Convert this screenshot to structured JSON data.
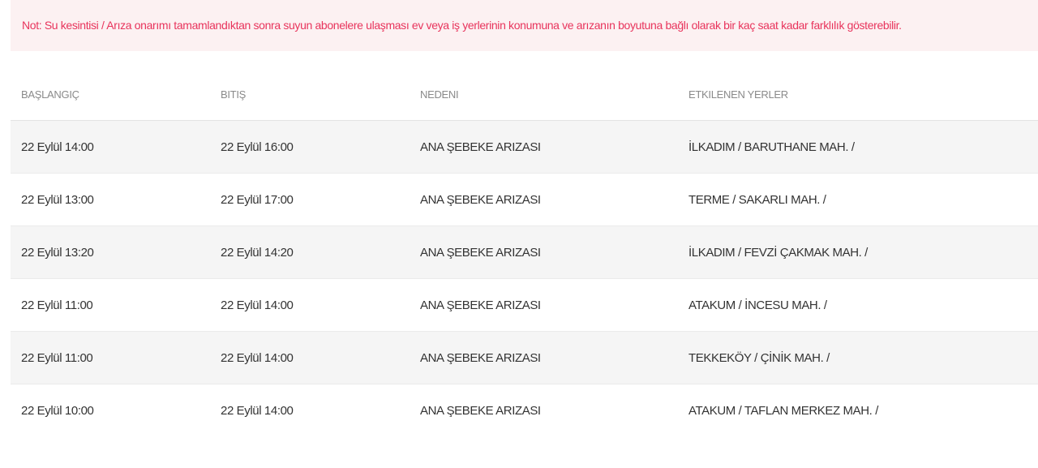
{
  "notice": {
    "text": "Not: Su kesintisi / Arıza onarımı tamamlandıktan sonra suyun abonelere ulaşması ev veya iş yerlerinin konumuna ve arızanın boyutuna bağlı olarak bir kaç saat kadar farklılık gösterebilir.",
    "color": "#e8345c",
    "background": "#fcf1f2"
  },
  "table": {
    "headers": [
      "BAŞLANGIÇ",
      "BITIŞ",
      "NEDENI",
      "ETKILENEN YERLER"
    ],
    "rows": [
      {
        "start": "22 Eylül 14:00",
        "end": "22 Eylül 16:00",
        "reason": "ANA ŞEBEKE ARIZASI",
        "areas": "İLKADIM / BARUTHANE MAH. /"
      },
      {
        "start": "22 Eylül 13:00",
        "end": "22 Eylül 17:00",
        "reason": "ANA ŞEBEKE ARIZASI",
        "areas": "TERME / SAKARLI MAH. /"
      },
      {
        "start": "22 Eylül 13:20",
        "end": "22 Eylül 14:20",
        "reason": "ANA ŞEBEKE ARIZASI",
        "areas": "İLKADIM / FEVZİ ÇAKMAK MAH. /"
      },
      {
        "start": "22 Eylül 11:00",
        "end": "22 Eylül 14:00",
        "reason": "ANA ŞEBEKE ARIZASI",
        "areas": "ATAKUM / İNCESU MAH. /"
      },
      {
        "start": "22 Eylül 11:00",
        "end": "22 Eylül 14:00",
        "reason": "ANA ŞEBEKE ARIZASI",
        "areas": "TEKKEKÖY / ÇİNİK MAH. /"
      },
      {
        "start": "22 Eylül 10:00",
        "end": "22 Eylül 14:00",
        "reason": "ANA ŞEBEKE ARIZASI",
        "areas": "ATAKUM / TAFLAN MERKEZ MAH. /"
      }
    ]
  }
}
